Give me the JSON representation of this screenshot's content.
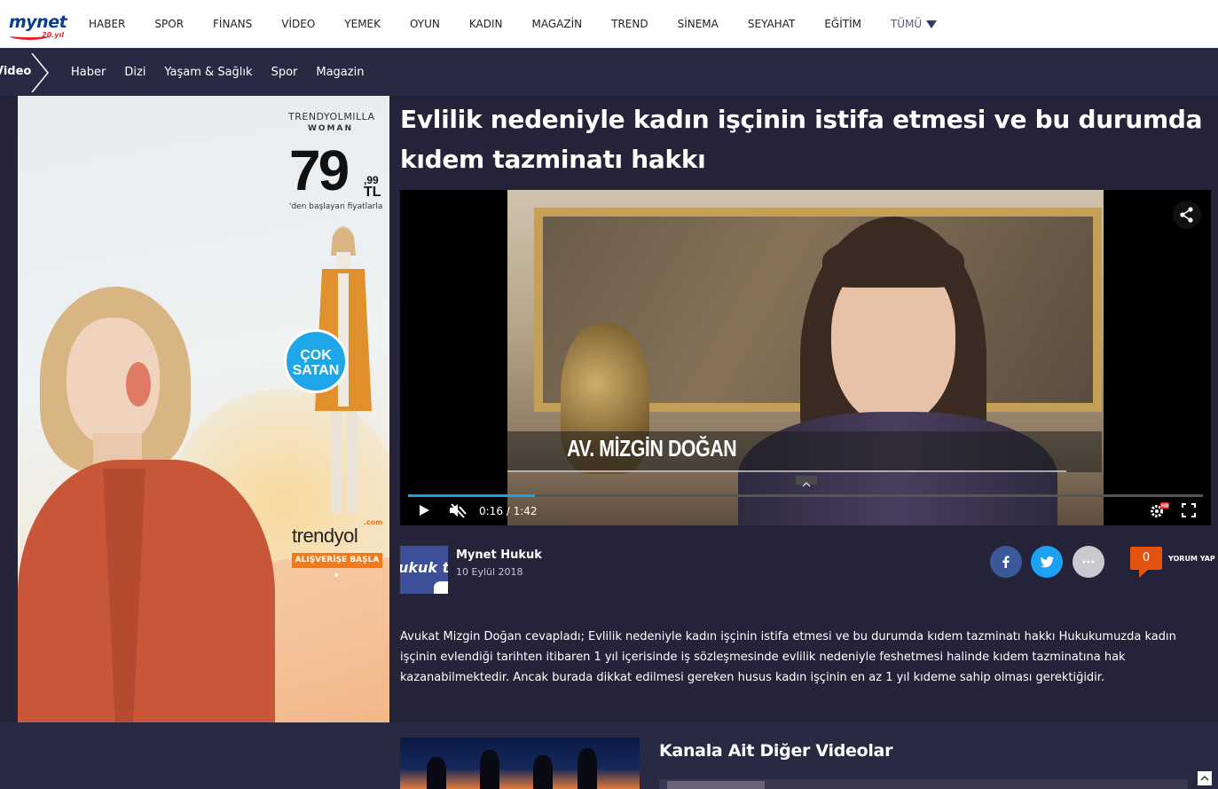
{
  "logo": {
    "text": "mynet",
    "sub": "20.yıl"
  },
  "topnav": {
    "items": [
      "HABER",
      "SPOR",
      "FİNANS",
      "VİDEO",
      "YEMEK",
      "OYUN",
      "KADIN",
      "MAGAZİN",
      "TREND",
      "SİNEMA",
      "SEYAHAT",
      "EĞİTİM"
    ],
    "more_label": "TÜMÜ"
  },
  "subnav": {
    "section": "Video",
    "items": [
      "Haber",
      "Dizi",
      "Yaşam & Sağlık",
      "Spor",
      "Magazin"
    ]
  },
  "ad": {
    "brand_line1": "TRENDYOLMILLA",
    "brand_line2": "WOMAN",
    "price_main": "79",
    "price_cents": ",99",
    "price_currency": "TL",
    "price_note": "'den başlayan fiyatlarla",
    "badge_line1": "ÇOK",
    "badge_line2": "SATAN",
    "logo_text": "trendyol",
    "logo_suffix": ".com",
    "cta": "ALIŞVERİŞE BAŞLA ▸"
  },
  "article": {
    "title": "Evlilik nedeniyle kadın işçinin istifa etmesi ve bu durumda kıdem tazminatı hakkı",
    "description": "Avukat Mizgin Doğan cevapladı; Evlilik nedeniyle kadın işçinin istifa etmesi ve bu durumda kıdem tazminatı hakkı Hukukumuzda kadın işçinin evlendiği tarihten itibaren 1 yıl içerisinde iş sözleşmesinde evlilik nedeniyle feshetmesi halinde kıdem tazminatına hak kazanabilmektedir. Ancak burada dikkat edilmesi gereken husus kadın işçinin en az 1 yıl kıdeme sahip olması gerektiğidir."
  },
  "video": {
    "lower_third_name": "AV. MİZGİN DOĞAN",
    "time_display": "0:16 / 1:42",
    "progress_fraction": 0.16,
    "hd_badge": "HD"
  },
  "author": {
    "avatar_text": "ukuk tv",
    "name": "Mynet Hukuk",
    "date": "10 Eylül 2018"
  },
  "actions": {
    "comment_count": "0",
    "comment_label": "YORUM YAP"
  },
  "related": {
    "title": "Kanala Ait Diğer Videolar"
  },
  "colors": {
    "page_bg": "#24233a",
    "subnav_bg": "#2a2944",
    "accent_blue": "#1aa0e0",
    "facebook": "#3b5998",
    "twitter": "#1da1f2",
    "comment_orange": "#e2540f"
  }
}
